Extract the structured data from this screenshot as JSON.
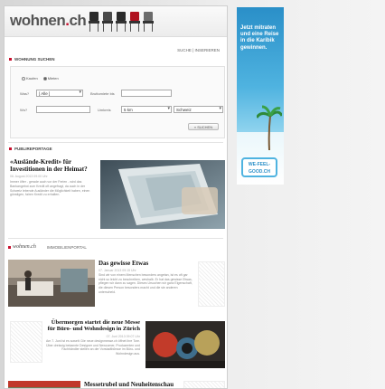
{
  "header": {
    "logo_main": "wohnen",
    "logo_dot": ".",
    "logo_tld": "ch",
    "chair_colors": [
      "#2b2b2b",
      "#4a4a4a",
      "#2b2b2b",
      "#b0111f",
      "#6b6b6b"
    ]
  },
  "top_links": "SUCHE | INSERIEREN",
  "search": {
    "title": "WOHNUNG SUCHEN",
    "radio_buy": "Kaufen",
    "radio_rent": "Mieten",
    "label_was": "Was?",
    "was_value": "[ Alle ]",
    "label_budget": "Bruttomiete bis",
    "budget_value": "",
    "label_wo": "Wo?",
    "wo_value": "",
    "label_umkreis": "Umkreis",
    "umkreis_value": "5 km",
    "country_value": "Schweiz",
    "button": "» SUCHEN"
  },
  "publi": {
    "title": "PUBLIREPORTAGE",
    "headline": "«Auslände-Kredit» für Investitionen in der Heimat?",
    "date": "06. August 2013 09:00 Uhr",
    "text": "Immer öfter - gerade auch vor der Ferien - wird das Bankangebot zum Kredit oft angefragt, da auch in der Schweiz lebende Ausländer die Möglichkeit haben, einen günstigen, fairen Kredit zu erhalten."
  },
  "portal": {
    "logo": "wohnen.ch",
    "label": "IMMOBILIENPORTAL"
  },
  "articles": [
    {
      "headline": "Das gewisse Etwas",
      "date": "07. Januar 2013 09:15 Uhr",
      "text": "Sind wir von einem Menschen besonders angetan, ist es oft gar nicht so leicht zu beschreiben, weshalb. Er hat das gewisse Etwas, pflegen wir dann zu sagen. Dieses Ursuchen wir ganz Eigenschaft, die diesen Person besonders macht und die sie anderen unterscheid."
    },
    {
      "headline": "Übermorgen startet die neue Messe für Büro- und Wohndesign in Zürich",
      "date": "07. Juni 2013 09:07 Uhr",
      "text": "Am 7. Juni ist es soweit: Die neue designmesse.ch öffnet ihre Tore. Über dreissig bekannte Designer und Newcomer, Produzenten und Fachhändler stellen an der Vorstadtbörsse im Büro- und Wohndesign aus."
    },
    {
      "headline": "Messetrubel und Neuheitenschau",
      "date": "",
      "text": ""
    }
  ],
  "ad": {
    "headline": "Jetzt mitraten und eine Reise in die Karibik gewinnen.",
    "badge_line1": "WE-FEEL-",
    "badge_line2": "GOOD.CH"
  }
}
